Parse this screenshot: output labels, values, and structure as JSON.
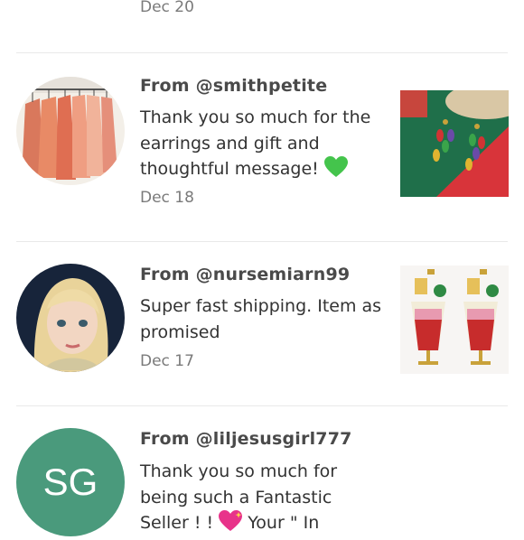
{
  "top_item": {
    "date": "Dec 20"
  },
  "reviews": [
    {
      "from": "From @smithpetite",
      "message": "Thank you so much for the earrings and gift and thoughtful message!",
      "date": "Dec 18",
      "emoji": "green-heart-icon"
    },
    {
      "from": "From @nursemiarn99",
      "message": "Super fast shipping. Item as promised",
      "date": "Dec 17"
    },
    {
      "from": "From @liljesusgirl777",
      "message": "Thank you so much for being such a Fantastic Seller ! !",
      "message_tail": "Your \" In",
      "avatar_initials": "SG",
      "emoji": "sparkling-heart-icon"
    }
  ],
  "colors": {
    "sg_avatar": "#4a9a7c",
    "divider": "#e9e9e9",
    "green_heart": "#44c44c",
    "pink_heart": "#e8338a"
  }
}
